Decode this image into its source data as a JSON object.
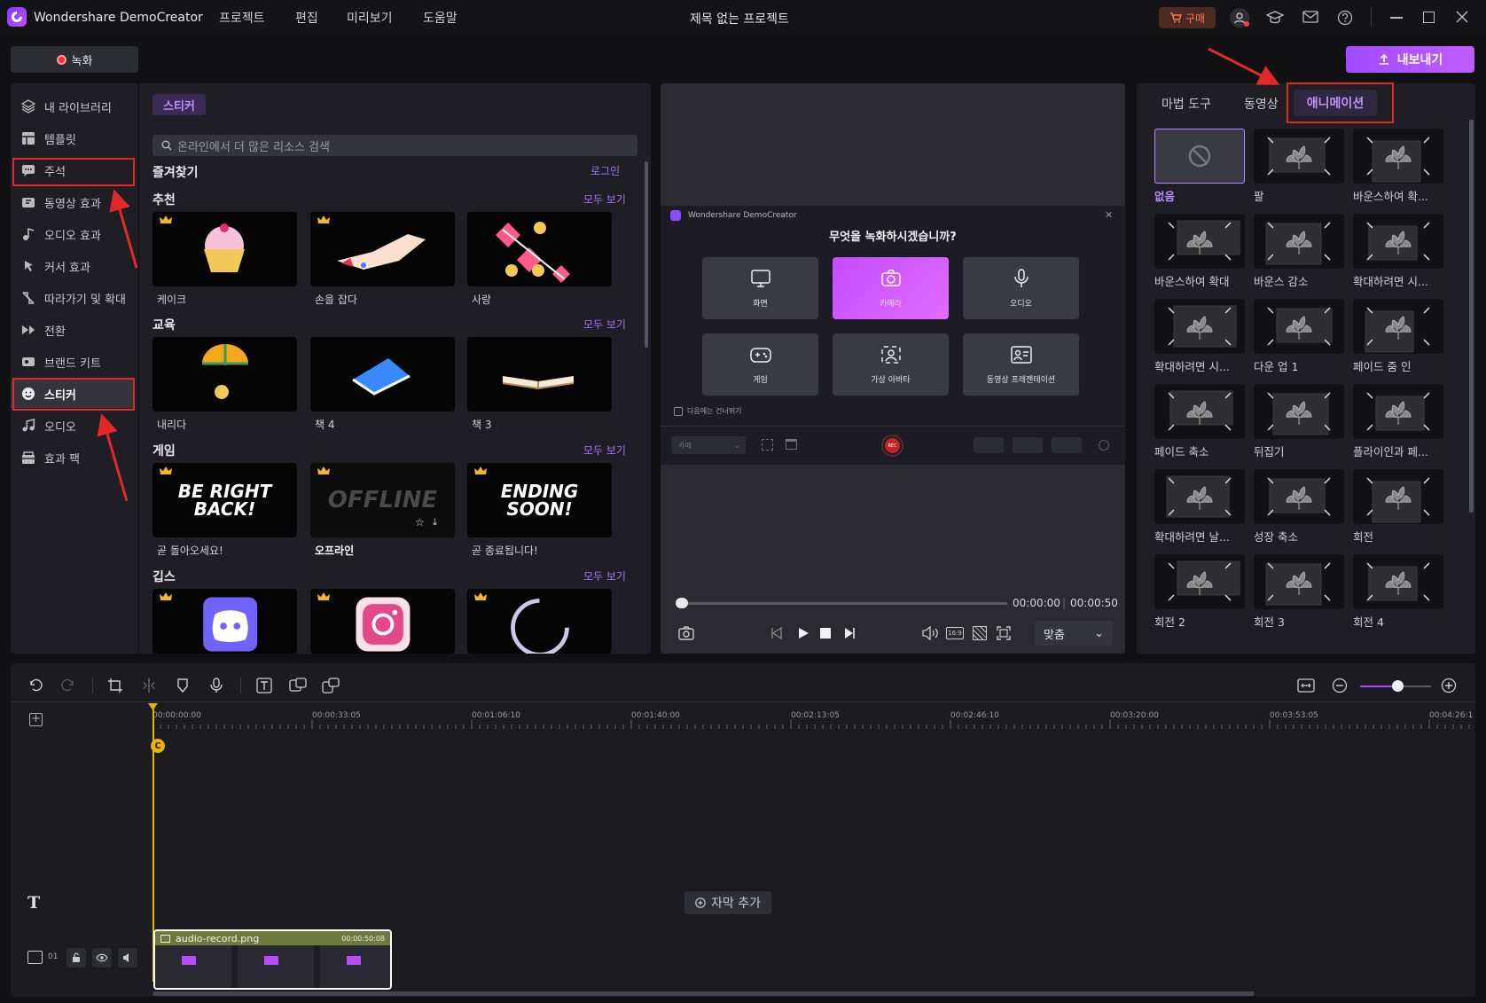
{
  "app": {
    "name": "Wondershare DemoCreator",
    "project_title": "제목 없는 프로젝트"
  },
  "menu": [
    "프로젝트",
    "편집",
    "미리보기",
    "도움말"
  ],
  "titlebar": {
    "buy_label": "구매"
  },
  "toolbar": {
    "record_label": "녹화",
    "export_label": "내보내기"
  },
  "sidebar": {
    "items": [
      {
        "label": "내 라이브러리",
        "icon": "layers-icon"
      },
      {
        "label": "템플릿",
        "icon": "template-icon"
      },
      {
        "label": "주석",
        "icon": "annotation-icon"
      },
      {
        "label": "동영상 효과",
        "icon": "video-effect-icon"
      },
      {
        "label": "오디오 효과",
        "icon": "audio-effect-icon"
      },
      {
        "label": "커서 효과",
        "icon": "cursor-icon"
      },
      {
        "label": "따라가기 및 확대",
        "icon": "zoom-follow-icon"
      },
      {
        "label": "전환",
        "icon": "transition-icon"
      },
      {
        "label": "브랜드 키트",
        "icon": "brand-icon"
      },
      {
        "label": "스티커",
        "icon": "sticker-icon"
      },
      {
        "label": "오디오",
        "icon": "music-icon"
      },
      {
        "label": "효과 팩",
        "icon": "effect-pack-icon"
      }
    ],
    "active": "스티커"
  },
  "library": {
    "tab": "스티커",
    "search_placeholder": "온라인에서 더 많은 리소스 검색",
    "favorites_title": "즐겨찾기",
    "login_label": "로그인",
    "see_all": "모두 보기",
    "sections": [
      {
        "title": "추천",
        "items": [
          {
            "label": "케이크",
            "premium": true
          },
          {
            "label": "손을 잡다",
            "premium": true
          },
          {
            "label": "사랑",
            "premium": false
          }
        ]
      },
      {
        "title": "교육",
        "items": [
          {
            "label": "내리다",
            "premium": false
          },
          {
            "label": "책 4",
            "premium": false
          },
          {
            "label": "책 3",
            "premium": false
          }
        ]
      },
      {
        "title": "게임",
        "items": [
          {
            "label": "곧 돌아오세요!",
            "art": "BE RIGHT\nBACK!",
            "premium": true
          },
          {
            "label": "오프라인",
            "art": "OFFLINE",
            "premium": true
          },
          {
            "label": "곧 종료됩니다!",
            "art": "ENDING\nSOON!",
            "premium": true
          }
        ]
      },
      {
        "title": "깁스",
        "items": [
          {
            "label": "discord",
            "premium": true
          },
          {
            "label": "instagram",
            "premium": true
          },
          {
            "label": "loading",
            "premium": true
          }
        ]
      }
    ]
  },
  "recorder_dialog": {
    "brand": "Wondershare DemoCreator",
    "question": "무엇을 녹화하시겠습니까?",
    "options": [
      "화면",
      "카메라",
      "오디오",
      "게임",
      "가상 아바타",
      "동영상 프레젠테이션"
    ],
    "selected": "카메라",
    "skip_label": "다음에는 건너뛰기",
    "dropdown_value": "카메",
    "rec_label": "REC"
  },
  "player": {
    "current_time": "00:00:00",
    "total_time": "00:00:50",
    "fit_label": "맞춤"
  },
  "effects_panel": {
    "tabs": [
      "마법 도구",
      "동영상",
      "애니메이션"
    ],
    "active_tab": "애니메이션",
    "items": [
      "없음",
      "팔",
      "바운스하여 확...",
      "바운스하여 확대",
      "바운스 감소",
      "확대하려면 시...",
      "확대하려면 시...",
      "다운 업 1",
      "페이드 줌 인",
      "페이드 축소",
      "뒤집기",
      "플라이인과 페...",
      "확대하려면 날...",
      "성장 축소",
      "회전",
      "회전 2",
      "회전 3",
      "회전 4"
    ]
  },
  "timeline": {
    "ticks": [
      "00:00:00:00",
      "00:00:33:05",
      "00:01:06:10",
      "00:01:40:00",
      "00:02:13:05",
      "00:02:46:10",
      "00:03:20:00",
      "00:03:53:05",
      "00:04:26:1"
    ],
    "add_subtitle_label": "자막 추가",
    "track_number": "01",
    "clip": {
      "name": "audio-record.png",
      "duration": "00:00:50:08"
    }
  },
  "colors": {
    "accent": "#a04cff",
    "highlight": "#e02a2a",
    "bg": "#111114",
    "panel": "#1e1e24"
  }
}
